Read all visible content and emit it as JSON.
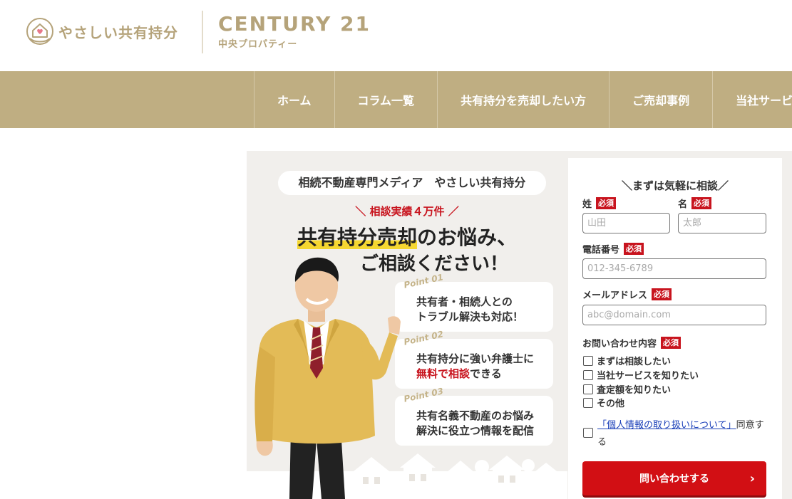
{
  "header": {
    "logo_text": "やさしい共有持分",
    "brand_title": "CENTURY 21",
    "brand_subtitle": "中央プロパティー"
  },
  "nav": {
    "items": [
      {
        "label": "ホーム"
      },
      {
        "label": "コラム一覧"
      },
      {
        "label": "共有持分を売却したい方"
      },
      {
        "label": "ご売却事例"
      },
      {
        "label": "当社サービス"
      }
    ]
  },
  "hero": {
    "media_label": "相続不動産専門メディア　やさしい共有持分",
    "results": "＼ 相談実績４万件 ／",
    "headline_highlight": "共有持分売却",
    "headline_rest": "のお悩み、",
    "headline_line2": "ご相談ください！",
    "points": [
      {
        "tag": "Point 01",
        "line1": "共有者・相続人との",
        "line2": "トラブル解決も対応！"
      },
      {
        "tag": "Point 02",
        "line1": "共有持分に強い弁護士に",
        "line2_red": "無料で相談",
        "line2_rest": "できる"
      },
      {
        "tag": "Point 03",
        "line1": "共有名義不動産のお悩み",
        "line2": "解決に役立つ情報を配信"
      }
    ]
  },
  "form": {
    "title": "＼まずは気軽に相談／",
    "required_badge": "必須",
    "last_name_label": "姓",
    "last_name_placeholder": "山田",
    "first_name_label": "名",
    "first_name_placeholder": "太郎",
    "phone_label": "電話番号",
    "phone_placeholder": "012-345-6789",
    "email_label": "メールアドレス",
    "email_placeholder": "abc@domain.com",
    "inquiry_label": "お問い合わせ内容",
    "inquiry_options": [
      "まずは相談したい",
      "当社サービスを知りたい",
      "査定額を知りたい",
      "その他"
    ],
    "privacy_link": "「個人情報の取り扱いについて」",
    "privacy_suffix": "同意する",
    "submit_label": "問い合わせする"
  },
  "colors": {
    "gold": "#bfae82",
    "brand_text": "#b5a37a",
    "red": "#c8141e",
    "hero_bg": "#f1efec"
  }
}
